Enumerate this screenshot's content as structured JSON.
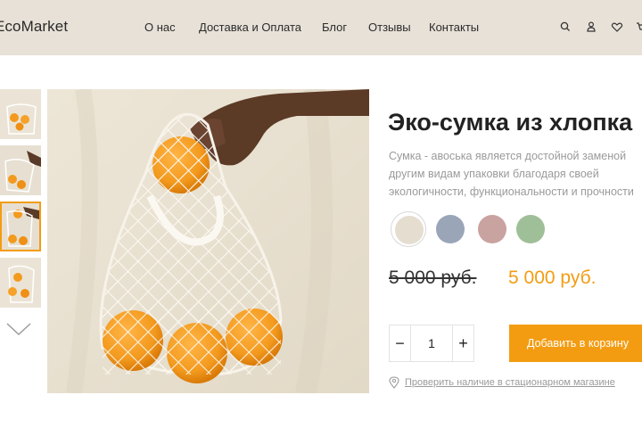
{
  "header": {
    "logo": "EcoMarket",
    "nav": [
      "О нас",
      "Доставка и Оплата",
      "Блог",
      "Отзывы",
      "Контакты"
    ],
    "icons": [
      "search-icon",
      "user-icon",
      "heart-icon",
      "cart-icon"
    ]
  },
  "gallery": {
    "thumbnails": 4,
    "active_thumbnail": 3,
    "arrow": "chevron-down-icon"
  },
  "product": {
    "title": "Эко-сумка из хлопка",
    "description": [
      "Сумка - авоська является достойной заменой",
      "другим видам упаковки благодаря своей",
      "экологичности, функциональности и прочности"
    ],
    "colors": [
      {
        "name": "beige",
        "hex": "#e5ddd0",
        "selected": true
      },
      {
        "name": "blue-gray",
        "hex": "#9aa5b8",
        "selected": false
      },
      {
        "name": "dusty-rose",
        "hex": "#c9a3a0",
        "selected": false
      },
      {
        "name": "sage-green",
        "hex": "#9fbf98",
        "selected": false
      }
    ],
    "old_price": "5 000 руб.",
    "price": "5 000 руб.",
    "quantity": "1",
    "minus_label": "−",
    "plus_label": "+",
    "add_to_cart_label": "Добавить в корзину",
    "store_link": "Проверить наличие в стационарном магазине"
  },
  "colors": {
    "accent": "#f39c12",
    "header_bg": "#e8e1d8",
    "muted_text": "#9a9a9a"
  }
}
